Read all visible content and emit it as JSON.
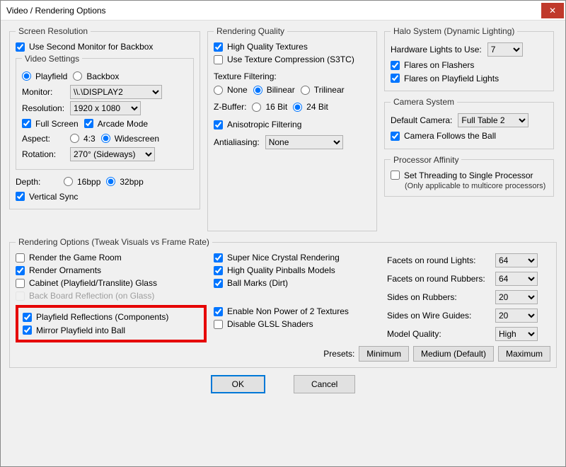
{
  "window": {
    "title": "Video / Rendering Options"
  },
  "screenRes": {
    "legend": "Screen Resolution",
    "useSecondMonitor": "Use Second Monitor for Backbox",
    "videoSettings": {
      "legend": "Video Settings",
      "playfield": "Playfield",
      "backbox": "Backbox",
      "monitorLabel": "Monitor:",
      "monitorValue": "\\\\.\\DISPLAY2",
      "resolutionLabel": "Resolution:",
      "resolutionValue": "1920 x 1080",
      "fullScreen": "Full Screen",
      "arcadeMode": "Arcade Mode",
      "aspectLabel": "Aspect:",
      "aspect43": "4:3",
      "aspectWide": "Widescreen",
      "rotationLabel": "Rotation:",
      "rotationValue": "270° (Sideways)"
    },
    "depthLabel": "Depth:",
    "depth16": "16bpp",
    "depth32": "32bpp",
    "vsync": "Vertical Sync"
  },
  "renderQuality": {
    "legend": "Rendering Quality",
    "hqTextures": "High Quality Textures",
    "texCompression": "Use Texture Compression (S3TC)",
    "texFilterLabel": "Texture Filtering:",
    "tfNone": "None",
    "tfBilinear": "Bilinear",
    "tfTrilinear": "Trilinear",
    "zbufferLabel": "Z-Buffer:",
    "zb16": "16 Bit",
    "zb24": "24 Bit",
    "aniso": "Anisotropic Filtering",
    "aaLabel": "Antialiasing:",
    "aaValue": "None"
  },
  "halo": {
    "legend": "Halo System (Dynamic Lighting)",
    "hwLightsLabel": "Hardware Lights to Use:",
    "hwLightsValue": "7",
    "flaresFlashers": "Flares on Flashers",
    "flaresPlayfield": "Flares on Playfield Lights"
  },
  "camera": {
    "legend": "Camera System",
    "defaultLabel": "Default Camera:",
    "defaultValue": "Full Table 2",
    "followBall": "Camera Follows the Ball"
  },
  "affinity": {
    "legend": "Processor Affinity",
    "single": "Set Threading to Single Processor",
    "note": "(Only applicable to multicore processors)"
  },
  "renderOpts": {
    "legend": "Rendering Options (Tweak Visuals vs Frame Rate)",
    "gameRoom": "Render the Game Room",
    "ornaments": "Render Ornaments",
    "cabinetGlass": "Cabinet (Playfield/Translite) Glass",
    "backBoardRefl": "Back Board Reflection (on Glass)",
    "playfieldRefl": "Playfield Reflections (Components)",
    "mirrorBall": "Mirror Playfield into Ball",
    "crystal": "Super Nice Crystal Rendering",
    "hqPinballs": "High Quality Pinballs Models",
    "ballMarks": "Ball Marks (Dirt)",
    "npot": "Enable Non Power of 2 Textures",
    "disableGlsl": "Disable GLSL Shaders",
    "facetsLightsLabel": "Facets on round Lights:",
    "facetsLightsValue": "64",
    "facetsRubbersLabel": "Facets on round Rubbers:",
    "facetsRubbersValue": "64",
    "sidesRubbersLabel": "Sides on Rubbers:",
    "sidesRubbersValue": "20",
    "sidesWireLabel": "Sides on Wire Guides:",
    "sidesWireValue": "20",
    "modelQualityLabel": "Model Quality:",
    "modelQualityValue": "High",
    "presetsLabel": "Presets:",
    "presetMin": "Minimum",
    "presetMed": "Medium (Default)",
    "presetMax": "Maximum"
  },
  "buttons": {
    "ok": "OK",
    "cancel": "Cancel"
  }
}
